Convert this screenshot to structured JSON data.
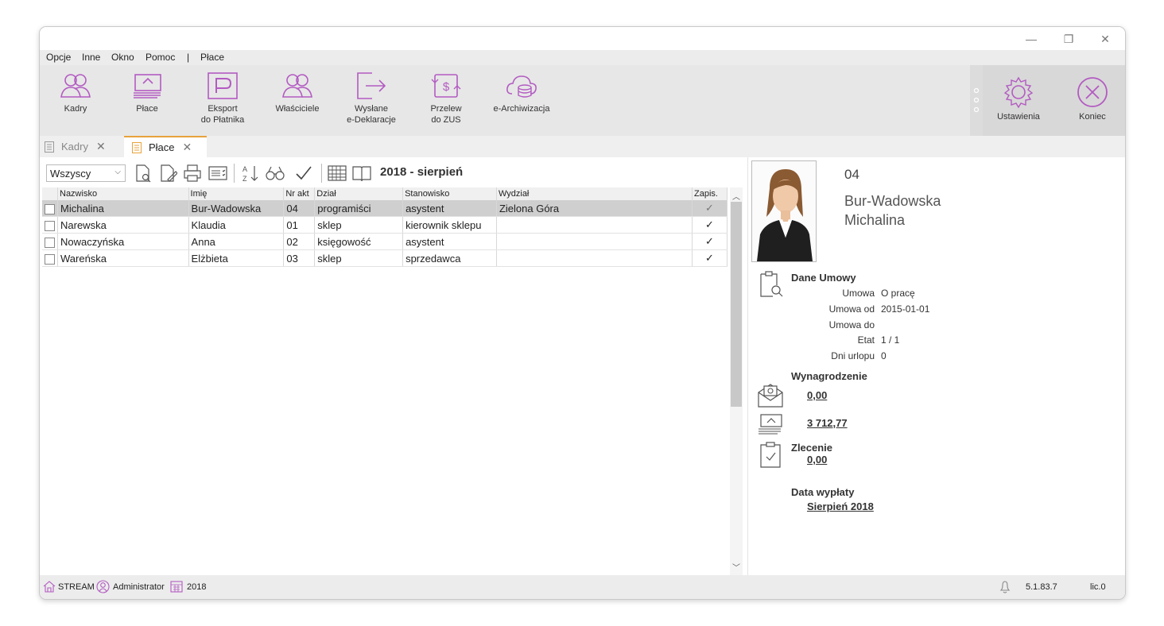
{
  "window": {
    "controls": {
      "minimize": "—",
      "maximize": "❐",
      "close": "✕"
    }
  },
  "menu": {
    "opcje": "Opcje",
    "inne": "Inne",
    "okno": "Okno",
    "pomoc": "Pomoc",
    "separator": "|",
    "place": "Płace"
  },
  "ribbon": {
    "kadry": "Kadry",
    "place": "Płace",
    "eksport_line1": "Eksport",
    "eksport_line2": "do Płatnika",
    "wlasciciele": "Właściciele",
    "wyslane_line1": "Wysłane",
    "wyslane_line2": "e-Deklaracje",
    "przelew_line1": "Przelew",
    "przelew_line2": "do ZUS",
    "earchiwizacja": "e-Archiwizacja",
    "ustawienia": "Ustawienia",
    "koniec": "Koniec"
  },
  "tabs": [
    {
      "label": "Kadry",
      "close": "✕"
    },
    {
      "label": "Płace",
      "close": "✕"
    }
  ],
  "toolbar": {
    "filter_value": "Wszyscy",
    "period": "2018 - sierpień"
  },
  "table": {
    "columns": [
      "Nazwisko",
      "Imię",
      "Nr akt",
      "Dział",
      "Stanowisko",
      "Wydział",
      "Zapis."
    ],
    "rows": [
      {
        "nazwisko": "Michalina",
        "imie": "Bur-Wadowska",
        "nr_akt": "04",
        "dzial": "programiści",
        "stanowisko": "asystent",
        "wydzial": "Zielona Góra",
        "zapis": "✓"
      },
      {
        "nazwisko": "Narewska",
        "imie": "Klaudia",
        "nr_akt": "01",
        "dzial": "sklep",
        "stanowisko": "kierownik sklepu",
        "wydzial": "",
        "zapis": "✓"
      },
      {
        "nazwisko": "Nowaczyńska",
        "imie": "Anna",
        "nr_akt": "02",
        "dzial": "księgowość",
        "stanowisko": "asystent",
        "wydzial": "",
        "zapis": "✓"
      },
      {
        "nazwisko": "Wareńska",
        "imie": "Elżbieta",
        "nr_akt": "03",
        "dzial": "sklep",
        "stanowisko": "sprzedawca",
        "wydzial": "",
        "zapis": "✓"
      }
    ]
  },
  "employee": {
    "nr_akt": "04",
    "surname": "Bur-Wadowska",
    "firstname": "Michalina",
    "contract": {
      "title": "Dane Umowy",
      "umowa_label": "Umowa",
      "umowa_value": "O pracę",
      "umowa_od_label": "Umowa od",
      "umowa_od_value": "2015-01-01",
      "umowa_do_label": "Umowa do",
      "etat_label": "Etat",
      "etat_value": "1 / 1",
      "dni_urlopu_label": "Dni urlopu",
      "dni_urlopu_value": "0"
    },
    "salary": {
      "title": "Wynagrodzenie",
      "amount1": "0,00",
      "amount2": "3 712,77"
    },
    "order": {
      "title": "Zlecenie",
      "amount": "0,00"
    },
    "payday": {
      "title": "Data wypłaty",
      "value": "Sierpień 2018"
    }
  },
  "status": {
    "stream": "STREAM",
    "user": "Administrator",
    "year": "2018",
    "version": "5.1.83.7",
    "licence": "lic.0"
  },
  "colors": {
    "accent": "#b35bc2",
    "ribbon_bg": "#e7e7e7",
    "selection": "#cfcfcf"
  }
}
